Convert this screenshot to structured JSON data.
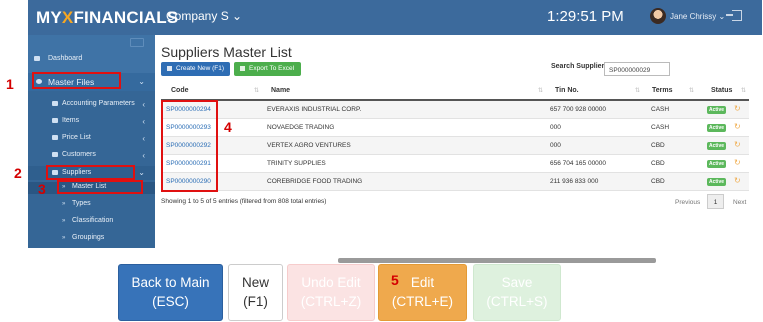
{
  "header": {
    "logo": {
      "part1": "MY",
      "part2": "X",
      "part3": "FINANCIALS"
    },
    "company": "Company S",
    "company_caret": "⌄",
    "clock": "1:29:51 PM",
    "user_name": "Jane Chrissy",
    "user_caret": "⌄"
  },
  "sidebar": {
    "dashboard": "Dashboard",
    "master_files": "Master Files",
    "accounting_parameters": "Accounting Parameters",
    "items": "Items",
    "price_list": "Price List",
    "customers": "Customers",
    "suppliers": "Suppliers",
    "master_list": "Master List",
    "types": "Types",
    "classification": "Classification",
    "groupings": "Groupings",
    "arrow_left": "‹",
    "arrow_down": "⌄",
    "bullet": "»"
  },
  "main": {
    "title": "Suppliers Master List",
    "create_button": "Create New (F1)",
    "export_button": "Export To Excel",
    "search_label": "Search Supplier:",
    "search_value": "SP000000029",
    "sort_glyph": "⇅",
    "columns": {
      "code": "Code",
      "name": "Name",
      "tin": "Tin No.",
      "terms": "Terms",
      "status": "Status"
    },
    "rows": [
      {
        "code": "SP0000000294",
        "name": "EVERAXIS INDUSTRIAL CORP.",
        "tin": "657 700 928 00000",
        "terms": "CASH",
        "status": "Active",
        "refresh": "↻"
      },
      {
        "code": "SP0000000293",
        "name": "NOVAEDGE TRADING",
        "tin": "000",
        "terms": "CASH",
        "status": "Active",
        "refresh": "↻"
      },
      {
        "code": "SP0000000292",
        "name": "VERTEX AGRO VENTURES",
        "tin": "000",
        "terms": "CBD",
        "status": "Active",
        "refresh": "↻"
      },
      {
        "code": "SP0000000291",
        "name": "TRINITY SUPPLIES",
        "tin": "656 704 165 00000",
        "terms": "CBD",
        "status": "Active",
        "refresh": "↻"
      },
      {
        "code": "SP0000000290",
        "name": "COREBRIDGE FOOD TRADING",
        "tin": "211 936 833 000",
        "terms": "CBD",
        "status": "Active",
        "refresh": "↻"
      }
    ],
    "showing": "Showing 1 to 5 of 5 entries (filtered from 808 total entries)",
    "pagination": {
      "previous": "Previous",
      "page": "1",
      "next": "Next"
    }
  },
  "function_keys": {
    "back": {
      "line1": "Back to Main",
      "line2": "(ESC)"
    },
    "new": {
      "line1": "New",
      "line2": "(F1)"
    },
    "undo": {
      "line1": "Undo Edit",
      "line2": "(CTRL+Z)"
    },
    "edit": {
      "line1": "Edit",
      "line2": "(CTRL+E)"
    },
    "save": {
      "line1": "Save",
      "line2": "(CTRL+S)"
    }
  },
  "annotations": {
    "n1": "1",
    "n2": "2",
    "n3": "3",
    "n4": "4",
    "n5": "5"
  },
  "colors": {
    "topbar": "#3c6a9c",
    "sidebar": "#3f73a6",
    "primary": "#2e6db4",
    "success": "#4cae4c",
    "edit": "#efa94d",
    "annotation": "#e01010"
  }
}
